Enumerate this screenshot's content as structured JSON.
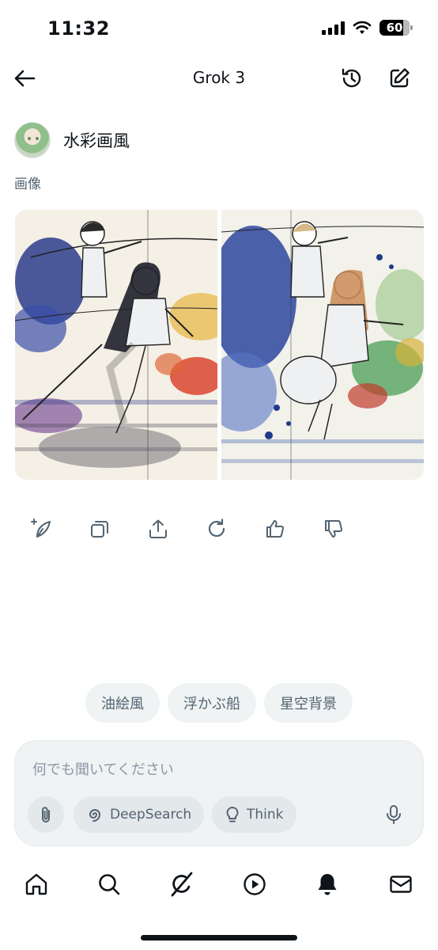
{
  "status": {
    "time": "11:32",
    "battery": "60"
  },
  "header": {
    "title": "Grok 3"
  },
  "message": {
    "user_text": "水彩画風",
    "section_label": "画像"
  },
  "images": [
    {
      "icon": "watercolor-anime-image-1"
    },
    {
      "icon": "watercolor-anime-image-2"
    }
  ],
  "suggestions": [
    "油絵風",
    "浮かぶ船",
    "星空背景"
  ],
  "composer": {
    "placeholder": "何でも聞いてください",
    "deepsearch_label": "DeepSearch",
    "think_label": "Think"
  },
  "colors": {
    "text": "#0f1419",
    "muted": "#536471",
    "surface": "#eff3f4"
  }
}
